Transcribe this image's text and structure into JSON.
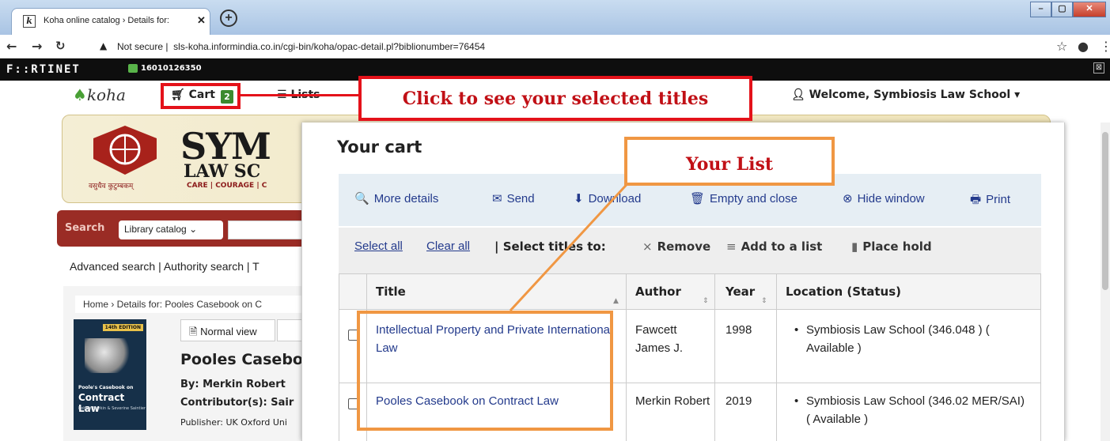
{
  "browser": {
    "tab_title": "Koha online catalog › Details for:",
    "tab_favicon": "k",
    "new_tab": "+",
    "address": "sls-koha.informindia.co.in/cgi-bin/koha/opac-detail.pl?biblionumber=76454",
    "security": "Not secure",
    "win_buttons": [
      "–",
      "▢",
      "✕"
    ]
  },
  "fortinet": {
    "logo": "F::RTINET",
    "id": "16010126350",
    "close": "⊠"
  },
  "header": {
    "logo": "koha",
    "cart_label": "Cart",
    "cart_count": "2",
    "lists_label": "Lists",
    "welcome": "Welcome, Symbiosis Law School"
  },
  "banner": {
    "name_line1": "SYM",
    "name_line2": "LAW SC",
    "tagline": "CARE | COURAGE | C",
    "motto": "वसुधैव कुटुम्बकम्"
  },
  "search": {
    "label": "Search",
    "catalog": "Library catalog"
  },
  "links": {
    "advanced": "Advanced search | Authority search | T"
  },
  "record": {
    "breadcrumb": "Home  ›  Details for: Pooles Casebook on C",
    "normal_view": "Normal view",
    "title": "Pooles Casebo",
    "author": "By: Merkin Robert",
    "contributors": "Contributor(s): Sair",
    "publisher": "Publisher: UK Oxford Uni",
    "cover_edition": "14th EDITION",
    "cover_title_small": "Poole's Casebook on",
    "cover_title": "Contract Law",
    "cover_authors": "Robert Merkin & Severine Saintier"
  },
  "cart": {
    "title": "Your cart",
    "actions": [
      "More details",
      "Send",
      "Download",
      "Empty and close",
      "Hide window",
      "Print"
    ],
    "action_icons": [
      "🔍",
      "✉",
      "⬇",
      "🗑",
      "⊗",
      "🖶"
    ],
    "select_all": "Select all",
    "clear_all": "Clear all",
    "select_titles": "| Select titles to:",
    "bulk": [
      "Remove",
      "Add to a list",
      "Place hold"
    ],
    "bulk_icons": [
      "×",
      "≡",
      "▮"
    ],
    "columns": [
      "Title",
      "Author",
      "Year",
      "Location (Status)"
    ],
    "rows": [
      {
        "title": "Intellectual Property and Private International Law",
        "author": "Fawcett James J.",
        "year": "1998",
        "location": "Symbiosis Law School (346.048 ) ( Available )"
      },
      {
        "title": "Pooles Casebook on Contract Law",
        "author": "Merkin Robert",
        "year": "2019",
        "location": "Symbiosis Law School (346.02 MER/SAI) ( Available )"
      }
    ]
  },
  "annotations": {
    "cart_callout": "Click to see your selected titles",
    "list_callout": "Your List"
  },
  "colors": {
    "callout_red": "#e4121a",
    "callout_orange": "#f09743",
    "link_blue": "#233a8c",
    "search_bar": "#9a2c25"
  }
}
